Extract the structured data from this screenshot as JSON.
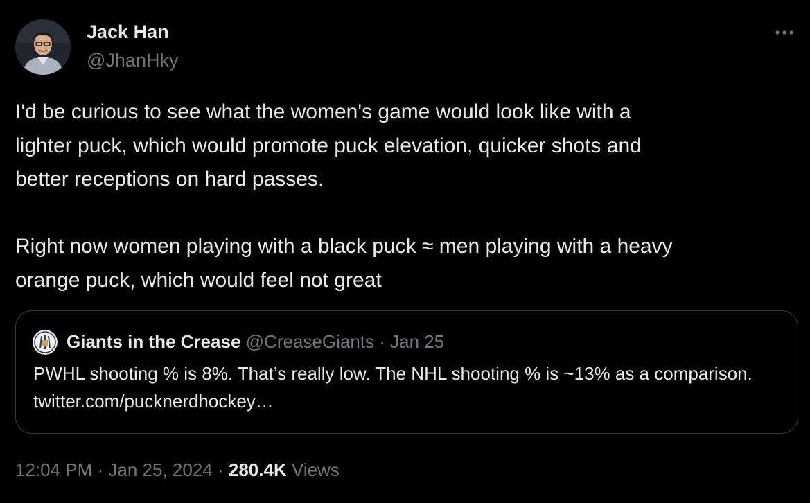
{
  "author": {
    "display_name": "Jack Han",
    "handle": "@JhanHky",
    "avatar_icon": "user-avatar-photo"
  },
  "more_icon": "more-horizontal-icon",
  "tweet": {
    "text": "I'd be curious to see what the women's game would look like with a\nlighter puck, which would promote puck elevation, quicker shots and\nbetter receptions on hard passes.\n\nRight now women playing with a black puck ≈ men playing with a heavy\norange puck, which would feel not great"
  },
  "quote": {
    "display_name": "Giants in the Crease",
    "handle": "@CreaseGiants",
    "separator": " · ",
    "date": "Jan 25",
    "avatar_icon": "giants-in-the-crease-logo",
    "text": "PWHL shooting % is 8%. That’s really low. The NHL shooting % is ~13% as a comparison. twitter.com/pucknerdhockey…"
  },
  "footer": {
    "time": "12:04 PM",
    "separator": " · ",
    "date": "Jan 25, 2024",
    "views_count": "280.4K",
    "views_label": " Views"
  },
  "colors": {
    "background": "#000000",
    "primary_text": "#e7e9ea",
    "secondary_text": "#71767b",
    "border": "#3a3d41"
  }
}
